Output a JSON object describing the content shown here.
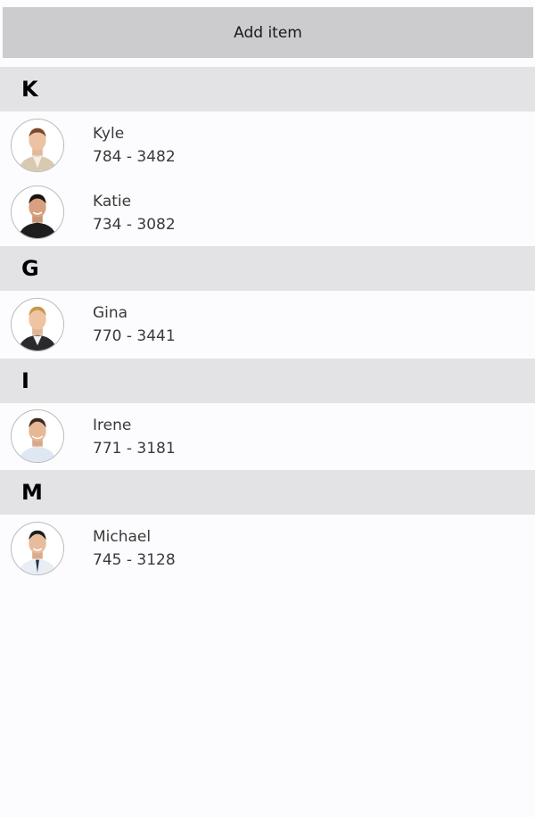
{
  "toolbar": {
    "add_label": "Add item"
  },
  "groups": [
    {
      "letter": "K",
      "contacts": [
        {
          "name": "Kyle",
          "phone": "784 - 3482",
          "avatar": "man-beige-suit-photo"
        },
        {
          "name": "Katie",
          "phone": "734 - 3082",
          "avatar": "man-black-shirt-photo"
        }
      ]
    },
    {
      "letter": "G",
      "contacts": [
        {
          "name": "Gina",
          "phone": "770 - 3441",
          "avatar": "man-dark-suit-photo"
        }
      ]
    },
    {
      "letter": "I",
      "contacts": [
        {
          "name": "Irene",
          "phone": "771 - 3181",
          "avatar": "man-light-shirt-photo"
        }
      ]
    },
    {
      "letter": "M",
      "contacts": [
        {
          "name": "Michael",
          "phone": "745 - 3128",
          "avatar": "man-shirt-tie-photo"
        }
      ]
    }
  ]
}
